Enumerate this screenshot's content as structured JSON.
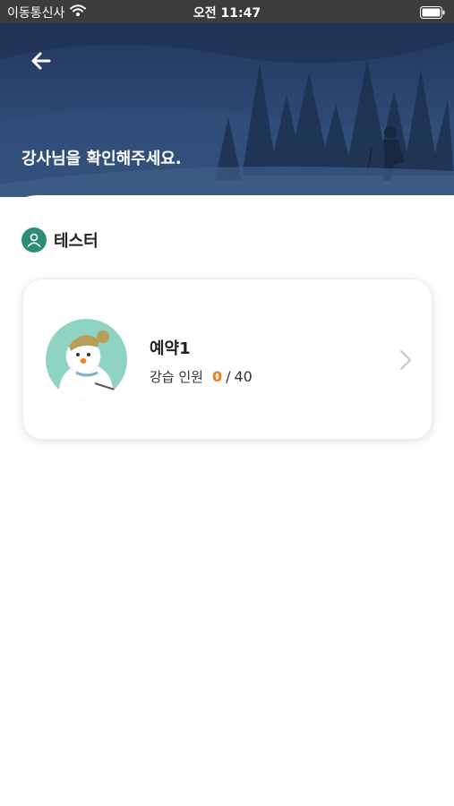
{
  "status_bar": {
    "carrier": "이동통신사",
    "time": "오전 11:47",
    "wifi_icon": "wifi-icon",
    "battery_icon": "battery-icon"
  },
  "header": {
    "back_icon": "arrow-left-icon",
    "title": "강사님을 확인해주세요."
  },
  "user": {
    "icon": "person-icon",
    "name": "테스터",
    "accent_color": "#2e8b7a"
  },
  "reservation": {
    "title": "예약1",
    "capacity_label": "강습 인원",
    "current": "0",
    "separator": "/",
    "max": "40",
    "current_color": "#f07a1a",
    "chevron_icon": "chevron-right-icon",
    "avatar": "snowman-avatar"
  }
}
